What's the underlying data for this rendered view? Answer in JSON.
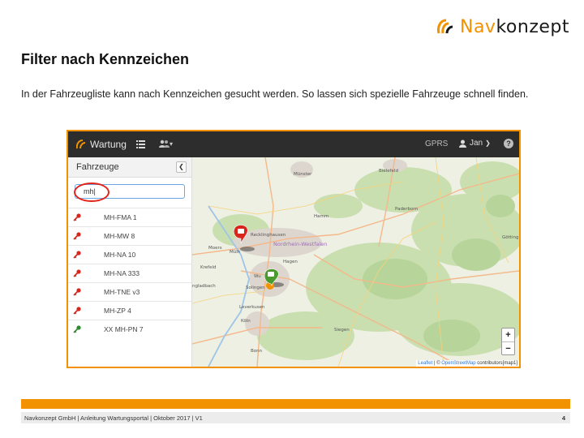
{
  "logo": {
    "part1": "Nav",
    "part2": "konzept"
  },
  "title": "Filter nach Kennzeichen",
  "intro": "In der Fahrzeugliste kann nach Kennzeichen gesucht werden. So lassen sich spezielle Fahrzeuge schnell finden.",
  "app": {
    "brand": "Wartung",
    "gprs": "GPRS",
    "user": "Jan",
    "help": "?",
    "panel_title": "Fahrzeuge",
    "search_value": "mh|",
    "vehicles": [
      {
        "plate": "MH-FMA 1",
        "key_color": "#d9261c"
      },
      {
        "plate": "MH-MW 8",
        "key_color": "#d9261c"
      },
      {
        "plate": "MH-NA 10",
        "key_color": "#d9261c"
      },
      {
        "plate": "MH-NA 333",
        "key_color": "#d9261c"
      },
      {
        "plate": "MH-TNE v3",
        "key_color": "#d9261c"
      },
      {
        "plate": "MH-ZP 4",
        "key_color": "#d9261c"
      },
      {
        "plate": "XX MH-PN 7",
        "key_color": "#2e8b2e"
      }
    ],
    "map_labels": {
      "bielefeld": "Bielefeld",
      "muenster": "Münster",
      "paderborn": "Paderborn",
      "hamm": "Hamm",
      "recklinghausen": "Recklinghausen",
      "nrw": "Nordrhein-Westfalen",
      "moers": "Moers",
      "muelheim": "Mülh",
      "krefeld": "Krefeld",
      "hagen": "Hagen",
      "gladbach": "ngladbach",
      "solingen": "Solingen",
      "wu": "Wu",
      "leverkusen": "Leverkusen",
      "koeln": "Köln",
      "siegen": "Siegen",
      "bonn": "Bonn",
      "goettingen": "Götting"
    },
    "zoom_in": "+",
    "zoom_out": "−",
    "attribution_leaflet": "Leaflet",
    "attribution_sep": " | © ",
    "attribution_osm": "OpenStreetMap",
    "attribution_rest": " contributors[map1]"
  },
  "footer": {
    "text": "Navkonzept GmbH  |  Anleitung Wartungsportal  |  Oktober 2017 | V1",
    "page": "4"
  },
  "colors": {
    "brand_orange": "#f39200",
    "marker_red": "#d9261c",
    "marker_green": "#4a9a2e"
  }
}
